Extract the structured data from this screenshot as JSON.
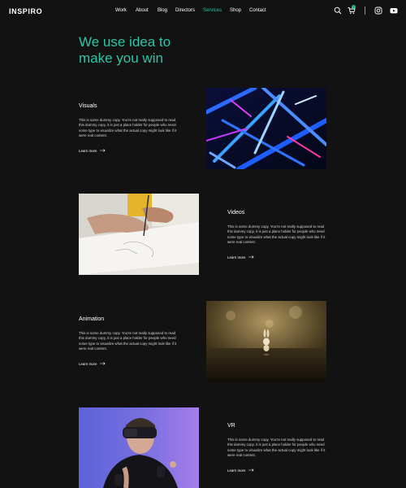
{
  "brand": {
    "logo": "INSPIRO"
  },
  "nav": {
    "items": [
      {
        "label": "Work",
        "active": false
      },
      {
        "label": "About",
        "active": false
      },
      {
        "label": "Blog",
        "active": false
      },
      {
        "label": "Directors",
        "active": false
      },
      {
        "label": "Services",
        "active": true
      },
      {
        "label": "Shop",
        "active": false
      },
      {
        "label": "Contact",
        "active": false
      }
    ]
  },
  "header_icons": {
    "search": "search-icon",
    "cart": "cart-icon",
    "cart_count": "0",
    "instagram": "instagram-icon",
    "youtube": "youtube-icon"
  },
  "hero": {
    "headline_line1": "We use idea to",
    "headline_line2": "make you win"
  },
  "services": [
    {
      "title": "Visuals",
      "body": "This is some dummy copy. You're not really supposed to read this dummy copy, it is just a place holder for people who need some type to visualize what the actual copy might look like if it were real content.",
      "link": "Learn more",
      "image": "neon-tubes-image"
    },
    {
      "title": "Videos",
      "body": "This is some dummy copy. You're not really supposed to read this dummy copy, it is just a place holder for people who need some type to visualize what the actual copy might look like if it were real content.",
      "link": "Learn more",
      "image": "hand-drawing-image"
    },
    {
      "title": "Animation",
      "body": "This is some dummy copy. You're not really supposed to read this dummy copy, it is just a place holder for people who need some type to visualize what the actual copy might look like if it were real content.",
      "link": "Learn more",
      "image": "bunny-figurine-image"
    },
    {
      "title": "VR",
      "body": "This is some dummy copy. You're not really supposed to read this dummy copy, it is just a place holder for people who need some type to visualize what the actual copy might look like if it were real content.",
      "link": "Learn more",
      "image": "vr-headset-man-image"
    }
  ],
  "colors": {
    "background": "#121212",
    "accent": "#2ec4a6",
    "text": "#ffffff",
    "body_text": "#d6d6d6"
  }
}
